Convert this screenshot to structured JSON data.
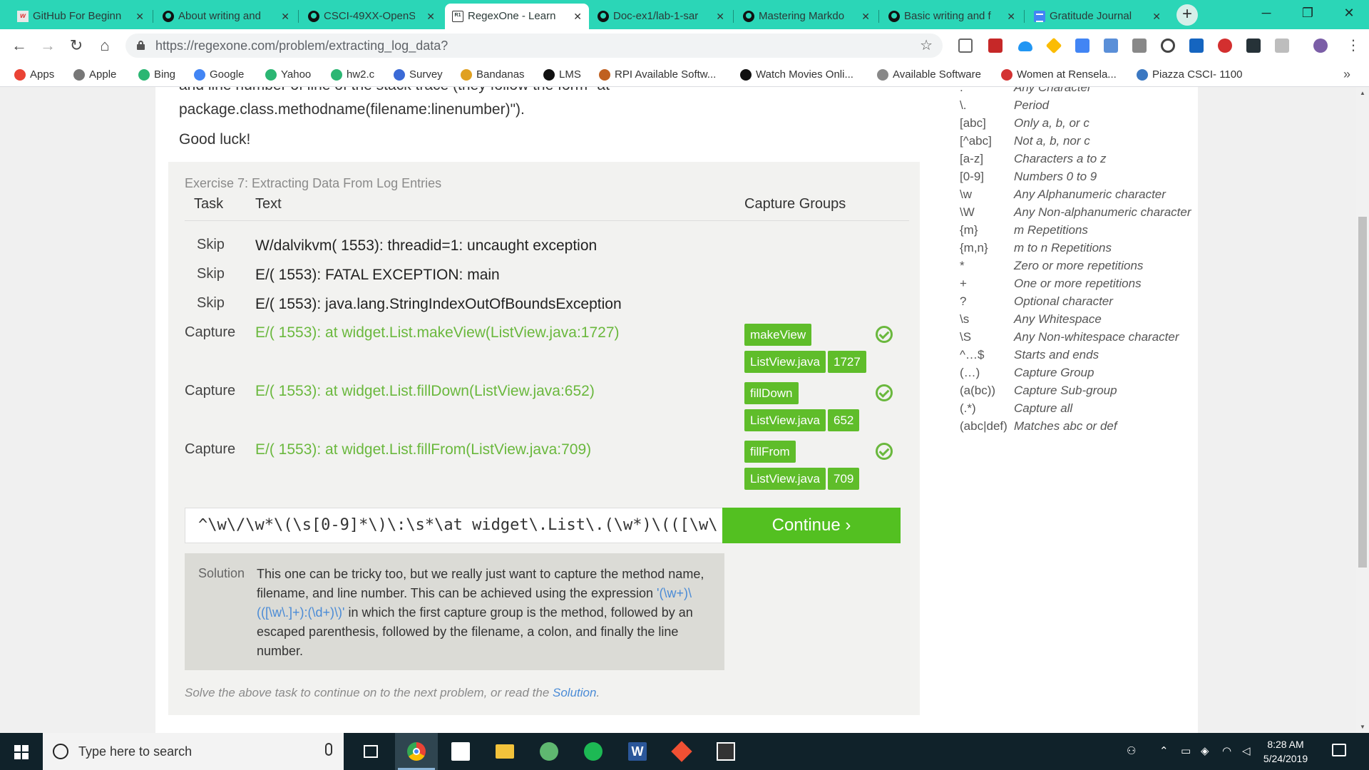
{
  "browser": {
    "tabs": [
      {
        "title": "GitHub For Beginn",
        "favicon": "w-icon",
        "active": false
      },
      {
        "title": "About writing and",
        "favicon": "github-icon",
        "active": false
      },
      {
        "title": "CSCI-49XX-OpenS",
        "favicon": "github-icon",
        "active": false
      },
      {
        "title": "RegexOne - Learn",
        "favicon": "regexone-icon",
        "active": true
      },
      {
        "title": "Doc-ex1/lab-1-sar",
        "favicon": "github-icon",
        "active": false
      },
      {
        "title": "Mastering Markdo",
        "favicon": "github-icon",
        "active": false
      },
      {
        "title": "Basic writing and f",
        "favicon": "github-icon",
        "active": false
      },
      {
        "title": "Gratitude Journal",
        "favicon": "docs-icon",
        "active": false
      }
    ],
    "close_glyph": "✕",
    "new_tab_glyph": "+",
    "url": "https://regexone.com/problem/extracting_log_data?",
    "bookmarks": [
      {
        "label": "Apps",
        "icon": "apps-grid-icon",
        "color": "#ea4335"
      },
      {
        "label": "Apple",
        "icon": "apple-icon",
        "color": "#777777"
      },
      {
        "label": "Bing",
        "icon": "globe-icon",
        "color": "#2bb673"
      },
      {
        "label": "Google",
        "icon": "google-icon",
        "color": "#4285f4"
      },
      {
        "label": "Yahoo",
        "icon": "globe-icon",
        "color": "#2bb673"
      },
      {
        "label": "hw2.c",
        "icon": "globe-icon",
        "color": "#2bb673"
      },
      {
        "label": "Survey",
        "icon": "survey-icon",
        "color": "#3b6ad6"
      },
      {
        "label": "Bandanas",
        "icon": "bandanas-icon",
        "color": "#e0a020"
      },
      {
        "label": "LMS",
        "icon": "lms-icon",
        "color": "#111111"
      },
      {
        "label": "RPI Available Softw...",
        "icon": "rpi-icon",
        "color": "#c06020"
      },
      {
        "label": "Watch Movies Onli...",
        "icon": "shield-icon",
        "color": "#111111"
      },
      {
        "label": "Available Software",
        "icon": "page-icon",
        "color": "#888888"
      },
      {
        "label": "Women at Rensela...",
        "icon": "women-icon",
        "color": "#d33333"
      },
      {
        "label": "Piazza CSCI- 1100",
        "icon": "piazza-icon",
        "color": "#3b78c2"
      }
    ],
    "bookmarks_more": "»"
  },
  "page": {
    "intro_lines": [
      "and line number of line of the stack trace (they follow the form \"at",
      "package.class.methodname(filename:linenumber)\").",
      "Good luck!"
    ],
    "exercise": {
      "title": "Exercise 7: Extracting Data From Log Entries",
      "headers": {
        "task": "Task",
        "text": "Text",
        "capture_groups": "Capture Groups"
      },
      "rows": [
        {
          "task": "Skip",
          "text": "W/dalvikvm( 1553): threadid=1: uncaught exception",
          "groups": []
        },
        {
          "task": "Skip",
          "text": "E/( 1553): FATAL EXCEPTION: main",
          "groups": []
        },
        {
          "task": "Skip",
          "text": "E/( 1553): java.lang.StringIndexOutOfBoundsException",
          "groups": []
        },
        {
          "task": "Capture",
          "text": "E/( 1553):   at widget.List.makeView(ListView.java:1727)",
          "groups": [
            "makeView",
            "ListView.java",
            "1727"
          ]
        },
        {
          "task": "Capture",
          "text": "E/( 1553):   at widget.List.fillDown(ListView.java:652)",
          "groups": [
            "fillDown",
            "ListView.java",
            "652"
          ]
        },
        {
          "task": "Capture",
          "text": "E/( 1553):   at widget.List.fillFrom(ListView.java:709)",
          "groups": [
            "fillFrom",
            "ListView.java",
            "709"
          ]
        }
      ],
      "regex_value": "^\\w\\/\\w*\\(\\s[0-9]*\\)\\:\\s*\\at widget\\.List\\.(\\w*)\\(([\\w\\",
      "continue_label": "Continue ›",
      "solution": {
        "label": "Solution",
        "text_before": "This one can be tricky too, but we really just want to capture the method name, filename, and line number. This can be achieved using the expression ",
        "code": "'(\\w+)\\(([\\w\\.]+):(\\d+)\\)'",
        "text_after": " in which the first capture group is the method, followed by an escaped parenthesis, followed by the filename, a colon, and finally the line number."
      },
      "hint_text": "Solve the above task to continue on to the next problem, or read the ",
      "hint_link": "Solution",
      "hint_end": "."
    },
    "cheatsheet": [
      {
        "symbol": ".",
        "description": "Any Character"
      },
      {
        "symbol": "\\.",
        "description": "Period"
      },
      {
        "symbol": "[abc]",
        "description": "Only a, b, or c"
      },
      {
        "symbol": "[^abc]",
        "description": "Not a, b, nor c"
      },
      {
        "symbol": "[a-z]",
        "description": "Characters a to z"
      },
      {
        "symbol": "[0-9]",
        "description": "Numbers 0 to 9"
      },
      {
        "symbol": "\\w",
        "description": "Any Alphanumeric character"
      },
      {
        "symbol": "\\W",
        "description": "Any Non-alphanumeric character"
      },
      {
        "symbol": "{m}",
        "description": "m Repetitions"
      },
      {
        "symbol": "{m,n}",
        "description": "m to n Repetitions"
      },
      {
        "symbol": "*",
        "description": "Zero or more repetitions"
      },
      {
        "symbol": "+",
        "description": "One or more repetitions"
      },
      {
        "symbol": "?",
        "description": "Optional character"
      },
      {
        "symbol": "\\s",
        "description": "Any Whitespace"
      },
      {
        "symbol": "\\S",
        "description": "Any Non-whitespace character"
      },
      {
        "symbol": "^…$",
        "description": "Starts and ends"
      },
      {
        "symbol": "(…)",
        "description": "Capture Group"
      },
      {
        "symbol": "(a(bc))",
        "description": "Capture Sub-group"
      },
      {
        "symbol": "(.*)",
        "description": "Capture all"
      },
      {
        "symbol": "(abc|def)",
        "description": "Matches abc or def"
      }
    ]
  },
  "taskbar": {
    "search_placeholder": "Type here to search",
    "apps": [
      "task-view-icon",
      "chrome-icon",
      "store-icon",
      "file-explorer-icon",
      "atom-icon",
      "spotify-icon",
      "word-icon",
      "git-icon",
      "photos-icon"
    ],
    "active_app": "chrome-icon",
    "time": "8:28 AM",
    "date": "5/24/2019"
  }
}
